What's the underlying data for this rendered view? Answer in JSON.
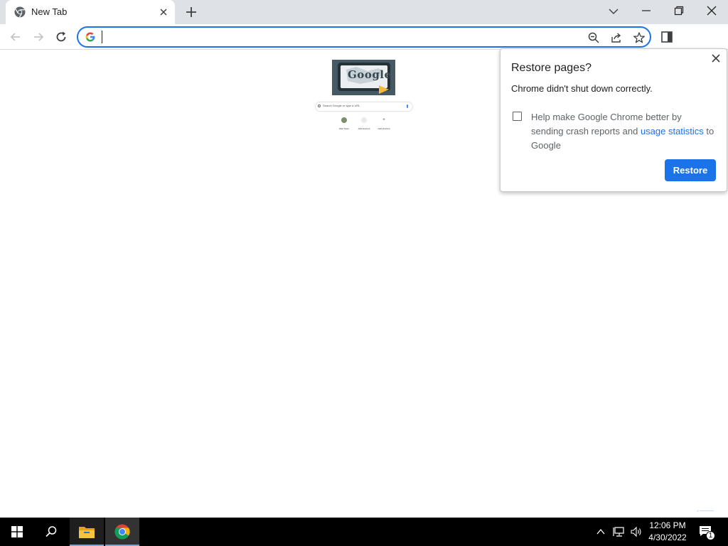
{
  "browser": {
    "tab": {
      "title": "New Tab",
      "favicon": "chromium-icon"
    },
    "omnibox": {
      "value": "",
      "placeholder": ""
    },
    "colors": {
      "accent": "#1a73e8",
      "titlebar": "#dee1e6"
    }
  },
  "page": {
    "doodle_text": "Google",
    "search_placeholder": "Search Google or type a URL",
    "shortcuts": [
      {
        "label": "Web Store"
      },
      {
        "label": "Add shortcut"
      },
      {
        "label": "Add shortcut"
      }
    ]
  },
  "restore_bubble": {
    "title": "Restore pages?",
    "message": "Chrome didn't shut down correctly.",
    "checkbox_text_before": "Help make Google Chrome better by sending crash reports and ",
    "link_text": "usage statistics",
    "checkbox_text_after": " to Google",
    "checked": false,
    "restore_label": "Restore"
  },
  "taskbar": {
    "time": "12:06 PM",
    "date": "4/30/2022",
    "notification_count": "1",
    "apps": [
      "start-icon",
      "search-icon",
      "file-explorer-icon",
      "chrome-icon"
    ]
  }
}
